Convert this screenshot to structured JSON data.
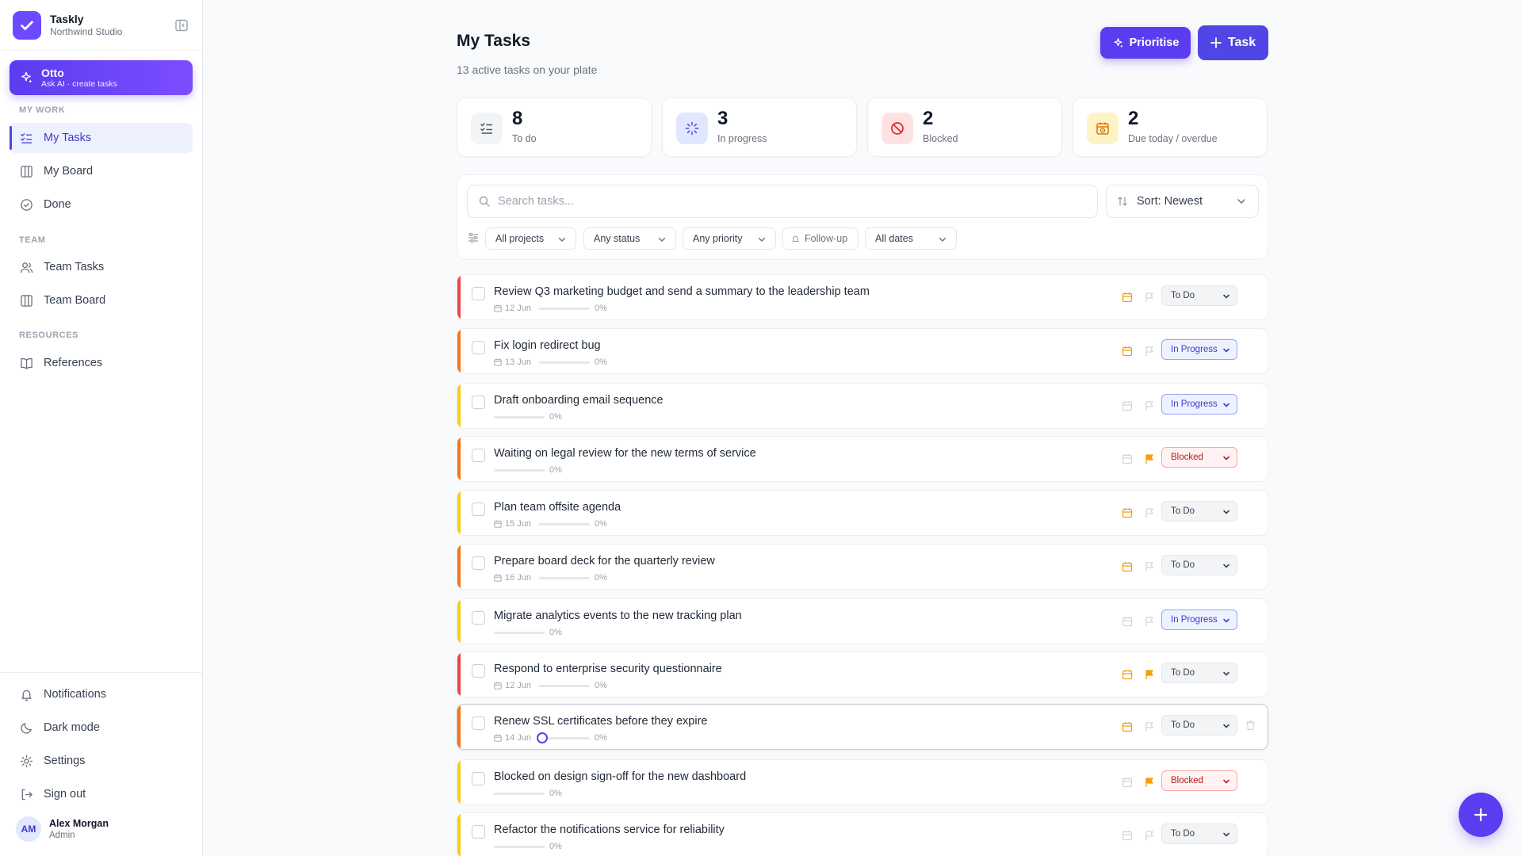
{
  "brand": {
    "name": "Taskly",
    "workspace": "Northwind Studio"
  },
  "assistant": {
    "name": "Otto",
    "subtitle": "Ask AI · create tasks"
  },
  "sidebar": {
    "sections": {
      "my_work": "MY WORK",
      "team": "TEAM",
      "resources": "RESOURCES"
    },
    "items": {
      "my_tasks": "My Tasks",
      "my_board": "My Board",
      "done": "Done",
      "team_tasks": "Team Tasks",
      "team_board": "Team Board",
      "references": "References"
    },
    "footer": {
      "notifications": "Notifications",
      "dark_mode": "Dark mode",
      "settings": "Settings",
      "sign_out": "Sign out"
    },
    "user": {
      "initials": "AM",
      "name": "Alex Morgan",
      "role": "Admin"
    }
  },
  "header": {
    "title": "My Tasks",
    "subtitle": "13 active tasks on your plate",
    "prioritise_label": "Prioritise",
    "task_label": "Task"
  },
  "stats": [
    {
      "value": "8",
      "label": "To do",
      "icon": "list-check-icon"
    },
    {
      "value": "3",
      "label": "In progress",
      "icon": "loader-icon"
    },
    {
      "value": "2",
      "label": "Blocked",
      "icon": "ban-icon"
    },
    {
      "value": "2",
      "label": "Due today / overdue",
      "icon": "calendar-clock-icon"
    }
  ],
  "filters": {
    "search_placeholder": "Search tasks...",
    "sort_label": "Sort: Newest",
    "projects": "All projects",
    "status": "Any status",
    "priority": "Any priority",
    "follow_up": "Follow-up",
    "dates": "All dates"
  },
  "tasks": [
    {
      "title": "Review Q3 marketing budget and send a summary to the leadership team",
      "date": "12 Jun",
      "progress": "0%",
      "status": "To Do"
    },
    {
      "title": "Fix login redirect bug",
      "date": "13 Jun",
      "progress": "0%",
      "status": "In Progress"
    },
    {
      "title": "Draft onboarding email sequence",
      "date": "",
      "progress": "0%",
      "status": "In Progress"
    },
    {
      "title": "Waiting on legal review for the new terms of service",
      "date": "",
      "progress": "0%",
      "status": "Blocked"
    },
    {
      "title": "Plan team offsite agenda",
      "date": "15 Jun",
      "progress": "0%",
      "status": "To Do"
    },
    {
      "title": "Prepare board deck for the quarterly review",
      "date": "16 Jun",
      "progress": "0%",
      "status": "To Do"
    },
    {
      "title": "Migrate analytics events to the new tracking plan",
      "date": "",
      "progress": "0%",
      "status": "In Progress"
    },
    {
      "title": "Respond to enterprise security questionnaire",
      "date": "12 Jun",
      "progress": "0%",
      "status": "To Do"
    },
    {
      "title": "Renew SSL certificates before they expire",
      "date": "14 Jun",
      "progress": "0%",
      "status": "To Do"
    },
    {
      "title": "Blocked on design sign-off for the new dashboard",
      "date": "",
      "progress": "0%",
      "status": "Blocked"
    },
    {
      "title": "Refactor the notifications service for reliability",
      "date": "",
      "progress": "0%",
      "status": "To Do"
    }
  ],
  "colors": {
    "accent": "#4f46e5",
    "priority_high": "#ef4444",
    "priority_medium": "#f97316",
    "priority_low": "#facc15"
  }
}
